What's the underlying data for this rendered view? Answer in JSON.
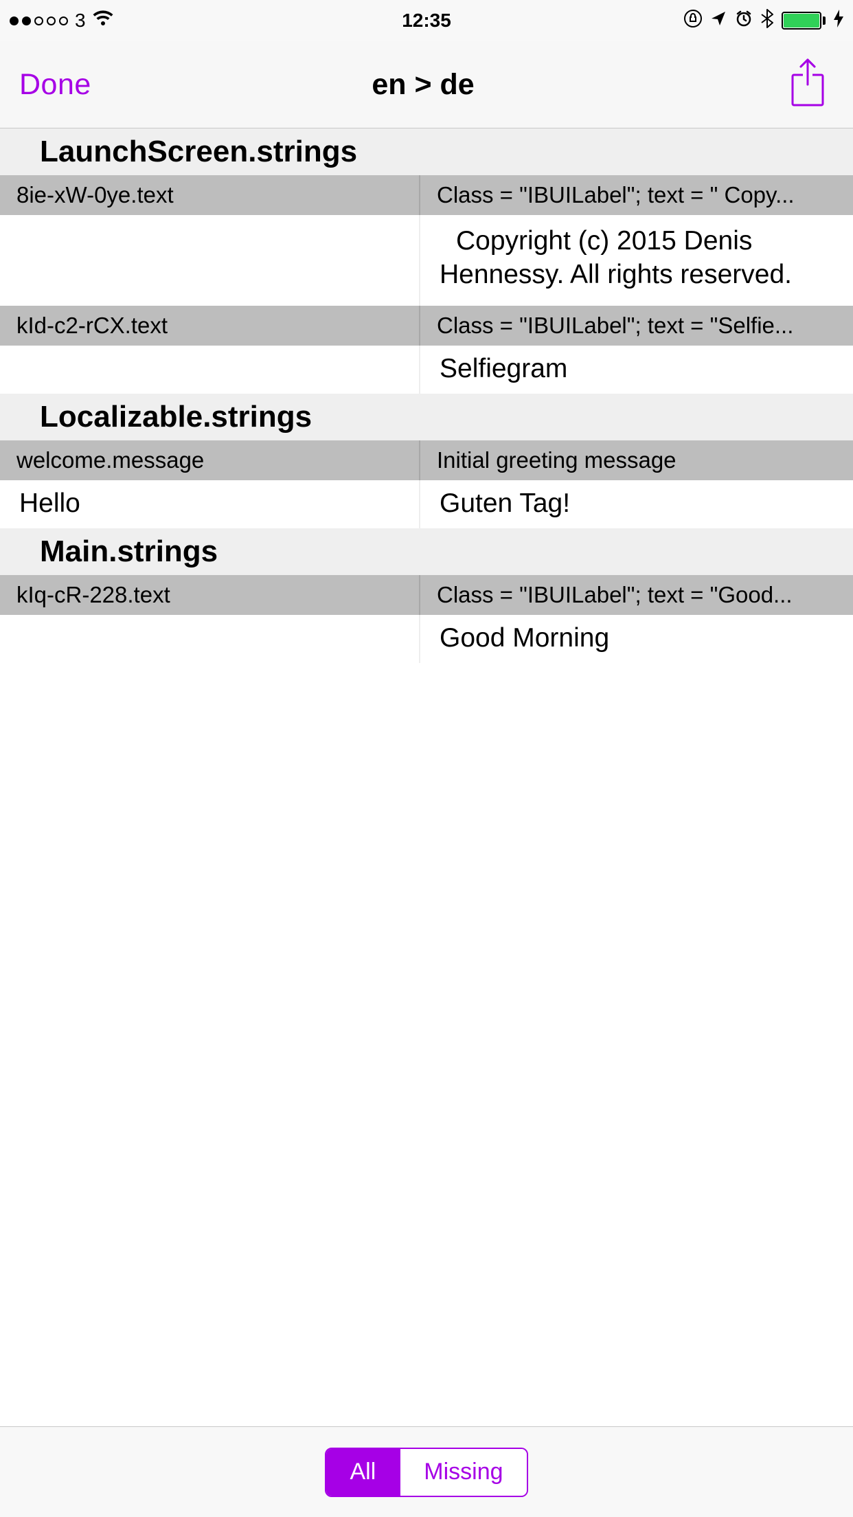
{
  "status": {
    "carrier": "3",
    "time": "12:35"
  },
  "nav": {
    "back": "Done",
    "title": "en > de"
  },
  "sections": [
    {
      "title": "LaunchScreen.strings",
      "rows": [
        {
          "key": "8ie-xW-0ye.text",
          "meta": "Class = \"IBUILabel\"; text = \"  Copy...",
          "source": "",
          "target": "  Copyright (c) 2015 Denis Hennessy. All rights reserved.",
          "multi": true,
          "indentFirst": true
        },
        {
          "key": "kId-c2-rCX.text",
          "meta": "Class = \"IBUILabel\"; text = \"Selfie...",
          "source": "",
          "target": "Selfiegram"
        }
      ]
    },
    {
      "title": "Localizable.strings",
      "rows": [
        {
          "key": "welcome.message",
          "meta": "Initial greeting message",
          "source": "Hello",
          "target": "Guten Tag!"
        }
      ]
    },
    {
      "title": "Main.strings",
      "rows": [
        {
          "key": "kIq-cR-228.text",
          "meta": "Class = \"IBUILabel\"; text = \"Good...",
          "source": "",
          "target": "Good Morning"
        }
      ]
    }
  ],
  "toolbar": {
    "segments": [
      "All",
      "Missing"
    ],
    "selectedIndex": 0
  },
  "accent": "#a600e6"
}
